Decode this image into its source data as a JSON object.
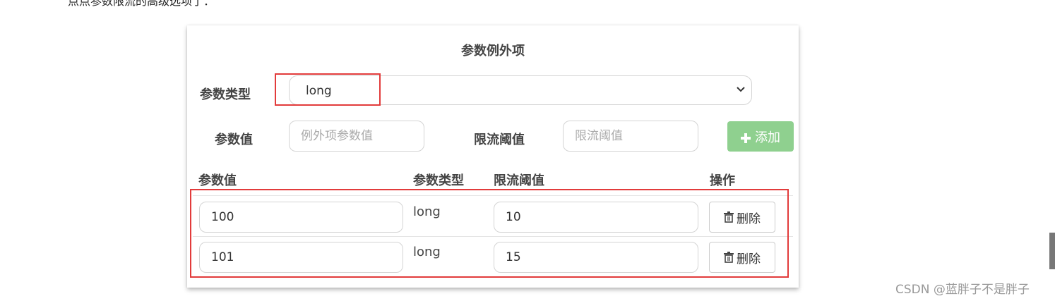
{
  "intro_text": "点点参数限流的高级选项了：",
  "panel": {
    "title": "参数例外项",
    "param_type_label": "参数类型",
    "param_type_value": "long",
    "param_value_label": "参数值",
    "param_value_placeholder": "例外项参数值",
    "threshold_label": "限流阈值",
    "threshold_placeholder": "限流阈值",
    "add_button": "添加"
  },
  "table": {
    "headers": [
      "参数值",
      "参数类型",
      "限流阈值",
      "操作"
    ],
    "rows": [
      {
        "param_value": "100",
        "param_type": "long",
        "threshold": "10",
        "action": "删除"
      },
      {
        "param_value": "101",
        "param_type": "long",
        "threshold": "15",
        "action": "删除"
      }
    ]
  },
  "watermark": "CSDN @蓝胖子不是胖子",
  "colors": {
    "highlight_border": "#e23b3b",
    "add_button_bg": "#8fd08f",
    "input_border": "#d4d4d4"
  },
  "icons": {
    "add": "plus-icon",
    "delete": "trash-icon",
    "select": "chevron-down-icon"
  }
}
